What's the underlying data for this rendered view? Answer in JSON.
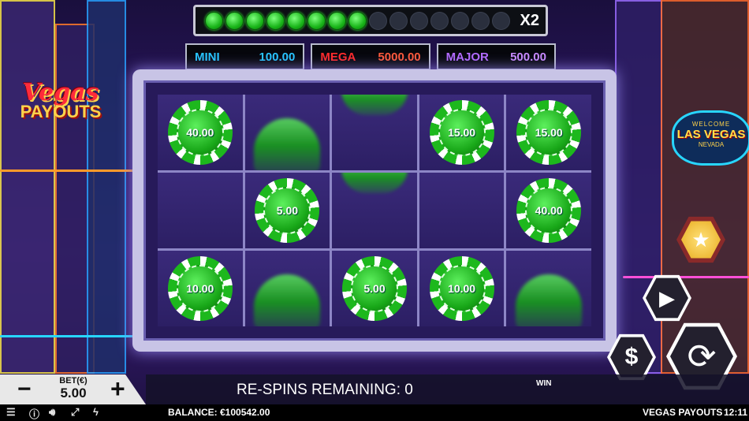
{
  "logo": {
    "line1": "Vegas",
    "line2": "PAYOUTS"
  },
  "sign": {
    "welcome": "WELCOME",
    "main": "LAS VEGAS",
    "state": "NEVADA"
  },
  "progress": {
    "filled": 8,
    "total": 15,
    "multiplier": "X2"
  },
  "jackpots": [
    {
      "name": "MINI",
      "value": "100.00"
    },
    {
      "name": "MEGA",
      "value": "5000.00"
    },
    {
      "name": "MAJOR",
      "value": "500.00"
    }
  ],
  "reels": [
    [
      {
        "type": "chip",
        "value": "40.00"
      },
      {
        "type": "blur-bottom"
      },
      {
        "type": "blur-top"
      },
      {
        "type": "chip",
        "value": "15.00"
      },
      {
        "type": "chip",
        "value": "15.00"
      }
    ],
    [
      {
        "type": "empty"
      },
      {
        "type": "chip",
        "value": "5.00"
      },
      {
        "type": "blur-top"
      },
      {
        "type": "empty"
      },
      {
        "type": "chip",
        "value": "40.00"
      }
    ],
    [
      {
        "type": "chip",
        "value": "10.00"
      },
      {
        "type": "blur-bottom"
      },
      {
        "type": "chip",
        "value": "5.00"
      },
      {
        "type": "chip",
        "value": "10.00"
      },
      {
        "type": "blur-bottom"
      }
    ]
  ],
  "bet": {
    "minus": "−",
    "plus": "+",
    "label": "BET(€)",
    "value": "5.00"
  },
  "info": {
    "respins": "RE-SPINS REMAINING: 0",
    "win_label": "WIN"
  },
  "status": {
    "balance": "BALANCE: €100542.00",
    "game_name": "VEGAS PAYOUTS",
    "time": "12:11"
  }
}
